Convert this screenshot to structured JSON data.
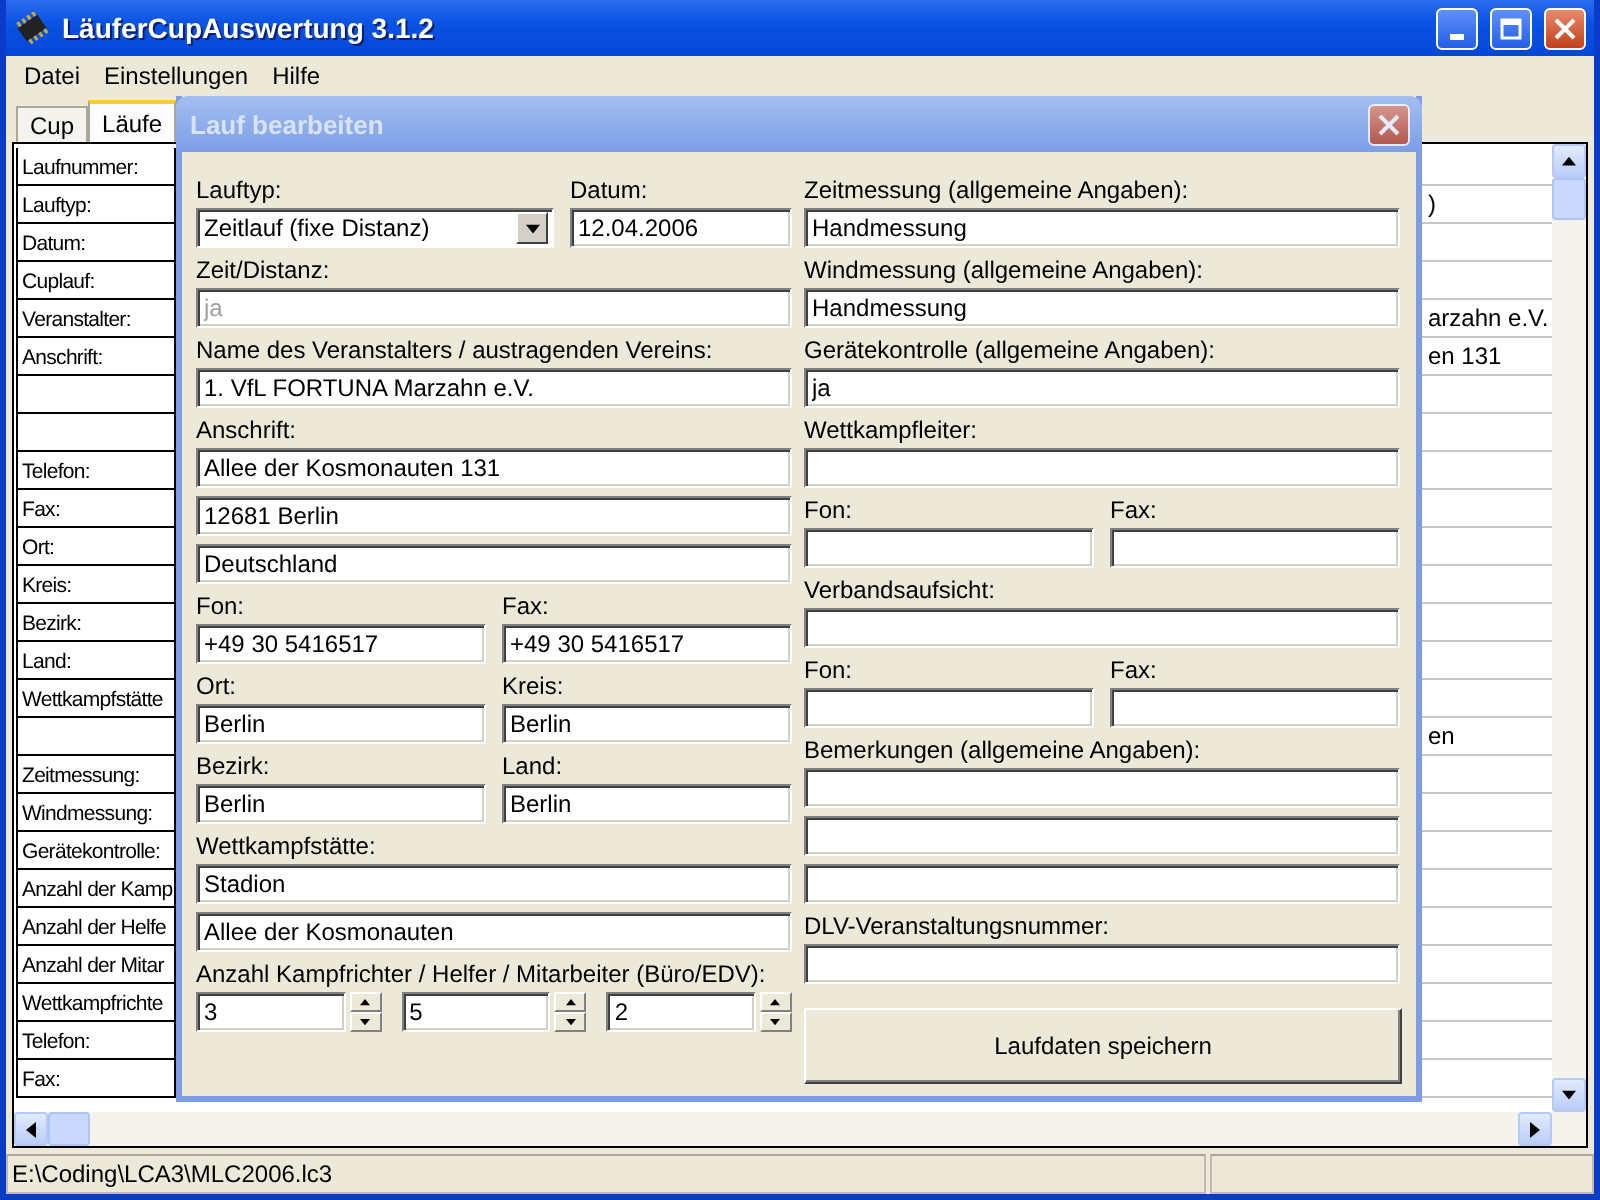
{
  "window": {
    "title": "LäuferCupAuswertung 3.1.2"
  },
  "menu": [
    "Datei",
    "Einstellungen",
    "Hilfe"
  ],
  "tabs": [
    {
      "label": "Cup",
      "selected": false
    },
    {
      "label": "Läufe",
      "selected": true
    }
  ],
  "grid_rows": [
    {
      "label": "Laufnummer:"
    },
    {
      "label": "Lauftyp:",
      "value": ")"
    },
    {
      "label": "Datum:"
    },
    {
      "label": "Cuplauf:"
    },
    {
      "label": "Veranstalter:",
      "value": "arzahn e.V."
    },
    {
      "label": "Anschrift:",
      "value": "en 131"
    },
    {},
    {},
    {
      "label": "Telefon:"
    },
    {
      "label": "Fax:"
    },
    {
      "label": "Ort:"
    },
    {
      "label": "Kreis:"
    },
    {
      "label": "Bezirk:"
    },
    {
      "label": "Land:"
    },
    {
      "label": "Wettkampfstätte"
    },
    {
      "value": "en"
    },
    {
      "label": "Zeitmessung:"
    },
    {
      "label": "Windmessung:"
    },
    {
      "label": "Gerätekontrolle:"
    },
    {
      "label": "Anzahl der Kamp"
    },
    {
      "label": "Anzahl der Helfe"
    },
    {
      "label": "Anzahl der Mitar"
    },
    {
      "label": "Wettkampfrichte"
    },
    {
      "label": "Telefon:"
    },
    {
      "label": "Fax:"
    }
  ],
  "status_bar": [
    "E:\\Coding\\LCA3\\MLC2006.lc3"
  ],
  "dialog": {
    "title": "Lauf bearbeiten",
    "left": [
      {
        "kind": "pair",
        "fields": [
          {
            "kind": "combo",
            "label": "Lauftyp:",
            "value": "Zeitlauf (fixe Distanz)",
            "disabled": false
          },
          {
            "kind": "field",
            "label": "Datum:",
            "value": "12.04.2006",
            "disabled": false
          }
        ]
      },
      {
        "kind": "field",
        "label": "Zeit/Distanz:",
        "value": "ja",
        "disabled": true
      },
      {
        "kind": "field",
        "label": "Name des Veranstalters / austragenden Vereins:",
        "value": "1. VfL FORTUNA Marzahn e.V.",
        "disabled": false
      },
      {
        "kind": "multi",
        "label": "Anschrift:",
        "values": [
          {
            "kind": "input",
            "value": "Allee der Kosmonauten 131"
          },
          {
            "kind": "input",
            "value": "12681 Berlin"
          },
          {
            "kind": "input",
            "value": "Deutschland"
          }
        ]
      },
      {
        "kind": "pair",
        "fields": [
          {
            "kind": "field",
            "label": "Fon:",
            "value": "+49 30 5416517",
            "disabled": false
          },
          {
            "kind": "field",
            "label": "Fax:",
            "value": "+49 30 5416517",
            "disabled": false
          }
        ]
      },
      {
        "kind": "pair",
        "fields": [
          {
            "kind": "field",
            "label": "Ort:",
            "value": "Berlin",
            "disabled": false
          },
          {
            "kind": "field",
            "label": "Kreis:",
            "value": "Berlin",
            "disabled": false
          }
        ]
      },
      {
        "kind": "pair",
        "fields": [
          {
            "kind": "field",
            "label": "Bezirk:",
            "value": "Berlin",
            "disabled": false
          },
          {
            "kind": "field",
            "label": "Land:",
            "value": "Berlin",
            "disabled": false
          }
        ]
      },
      {
        "kind": "multi",
        "label": "Wettkampfstätte:",
        "values": [
          {
            "kind": "input",
            "value": "Stadion"
          },
          {
            "kind": "input",
            "value": "Allee der Kosmonauten"
          }
        ]
      },
      {
        "kind": "spinners",
        "label": "Anzahl Kampfrichter / Helfer / Mitarbeiter (Büro/EDV):",
        "values": [
          "3",
          "5",
          "2"
        ]
      }
    ],
    "right": [
      {
        "kind": "field",
        "label": "Zeitmessung (allgemeine Angaben):",
        "value": "Handmessung",
        "disabled": false
      },
      {
        "kind": "field",
        "label": "Windmessung (allgemeine Angaben):",
        "value": "Handmessung",
        "disabled": false
      },
      {
        "kind": "field",
        "label": "Gerätekontrolle (allgemeine Angaben):",
        "value": "ja",
        "disabled": false
      },
      {
        "kind": "field",
        "label": "Wettkampfleiter:"
      },
      {
        "kind": "pair",
        "fields": [
          {
            "kind": "field",
            "label": "Fon:"
          },
          {
            "kind": "field",
            "label": "Fax:"
          }
        ]
      },
      {
        "kind": "field",
        "label": "Verbandsaufsicht:"
      },
      {
        "kind": "pair",
        "fields": [
          {
            "kind": "field",
            "label": "Fon:"
          },
          {
            "kind": "field",
            "label": "Fax:"
          }
        ]
      },
      {
        "kind": "multi",
        "label": "Bemerkungen (allgemeine Angaben):",
        "values": [
          {
            "kind": "input"
          },
          {
            "kind": "input"
          },
          {
            "kind": "input"
          }
        ]
      },
      {
        "kind": "field",
        "label": "DLV-Veranstaltungsnummer:"
      }
    ],
    "save_button": "Laufdaten speichern"
  }
}
